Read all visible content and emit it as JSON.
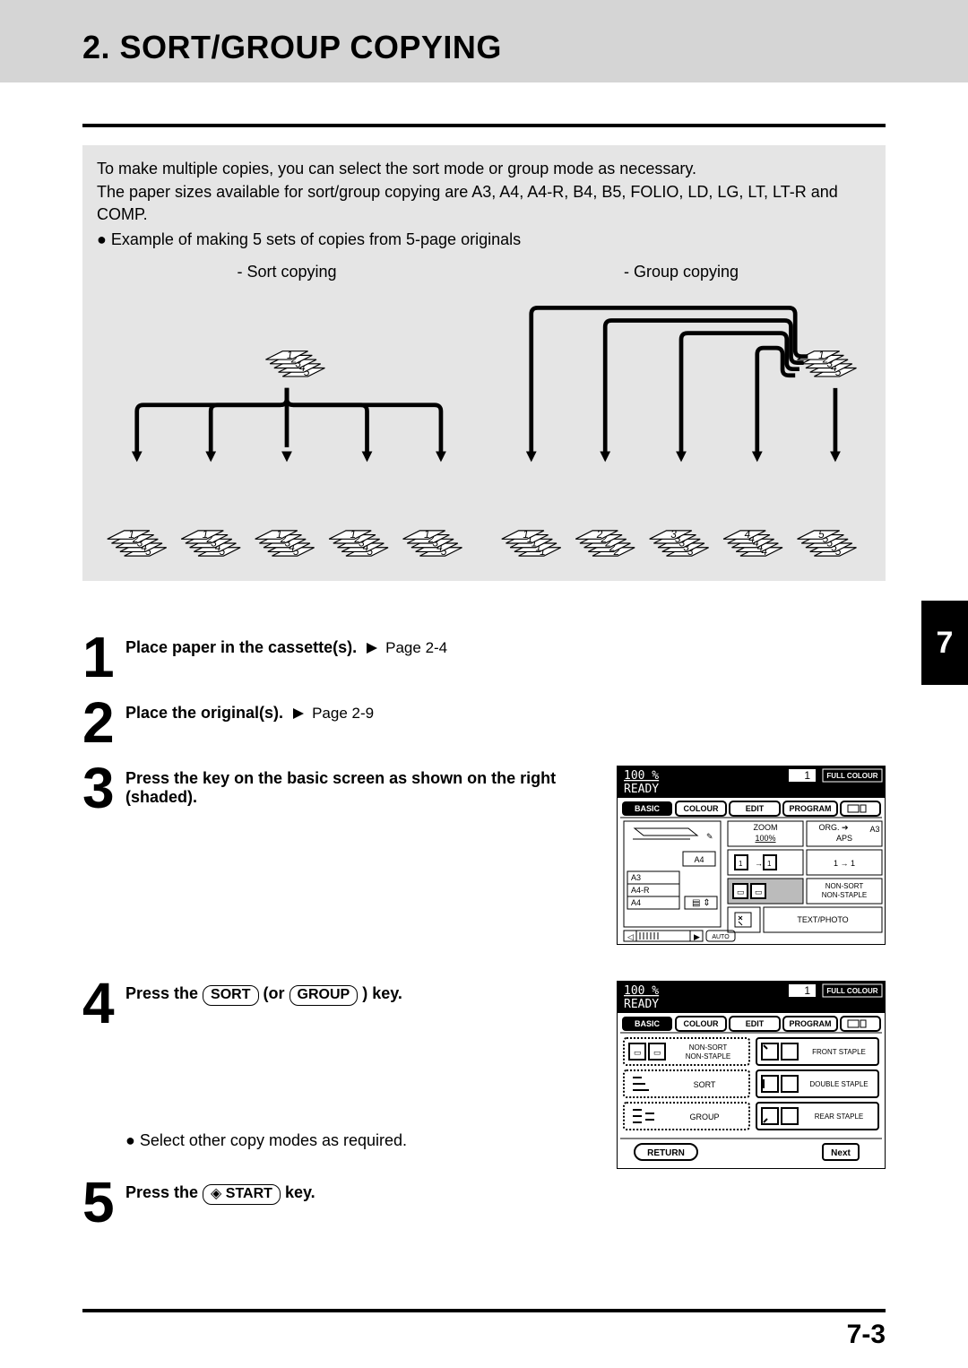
{
  "title": "2. SORT/GROUP COPYING",
  "intro": {
    "p1": "To make multiple copies, you can select the sort mode or group mode as necessary.",
    "p2": "The paper sizes available for sort/group copying are A3, A4, A4-R, B4, B5, FOLIO, LD, LG, LT, LT-R and COMP.",
    "p3": "Example of making 5 sets of copies from 5-page originals",
    "sort_cap": "- Sort copying",
    "group_cap": "- Group copying"
  },
  "steps": {
    "s1_bold": "Place paper in the cassette(s).",
    "s1_ref": "Page 2-4",
    "s2_bold": "Place the original(s).",
    "s2_ref": "Page 2-9",
    "s3_bold": "Press the key on the basic screen as shown on the right (shaded).",
    "s4_pre": "Press the ",
    "s4_sort": "SORT",
    "s4_mid": " (or ",
    "s4_group": "GROUP",
    "s4_post": ") key.",
    "s4_note": "Select other copy modes as required.",
    "s5_pre": "Press the ",
    "s5_start": "START",
    "s5_post": " key."
  },
  "screen1": {
    "zoom": "100  %",
    "ready": "READY",
    "qty": "1",
    "mode": "FULL COLOUR",
    "tabs": {
      "basic": "BASIC",
      "colour": "COLOUR",
      "edit": "EDIT",
      "program": "PROGRAM"
    },
    "zoomlbl": "ZOOM",
    "zoomval": "100%",
    "orglbl": "ORG.",
    "orgval": "APS",
    "orgsize": "A3",
    "dup": "1 → 1",
    "sizes": [
      "A3",
      "A4-R",
      "A4"
    ],
    "a4top": "A4",
    "nonsort": "NON-SORT",
    "nonstaple": "NON-STAPLE",
    "textphoto": "TEXT/PHOTO",
    "auto": "AUTO"
  },
  "screen2": {
    "zoom": "100  %",
    "ready": "READY",
    "qty": "1",
    "mode": "FULL COLOUR",
    "tabs": {
      "basic": "BASIC",
      "colour": "COLOUR",
      "edit": "EDIT",
      "program": "PROGRAM"
    },
    "nonsort": "NON-SORT",
    "nonstaple": "NON-STAPLE",
    "sort": "SORT",
    "group": "GROUP",
    "front": "FRONT STAPLE",
    "double": "DOUBLE STAPLE",
    "rear": "REAR  STAPLE",
    "return": "RETURN",
    "next": "Next"
  },
  "tab": "7",
  "page": "7-3"
}
